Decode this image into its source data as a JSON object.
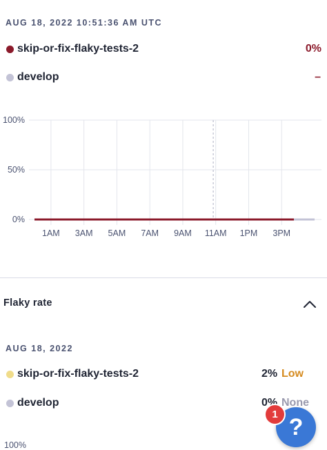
{
  "header": {
    "timestamp": "AUG 18, 2022 10:51:36 AM UTC"
  },
  "legend": [
    {
      "name": "skip-or-fix-flaky-tests-2",
      "value": "0%",
      "color": "#8b1a2b"
    },
    {
      "name": "develop",
      "value": "–",
      "color": "#c3c3d6"
    }
  ],
  "chart_data": {
    "type": "line",
    "y_ticks": [
      "100%",
      "50%",
      "0%"
    ],
    "x_ticks": [
      "1AM",
      "3AM",
      "5AM",
      "7AM",
      "9AM",
      "11AM",
      "1PM",
      "3PM"
    ],
    "ylim": [
      0,
      100
    ],
    "series": [
      {
        "name": "skip-or-fix-flaky-tests-2",
        "color": "#8b1a2b",
        "x": [
          "12AM",
          "3:45PM"
        ],
        "y": [
          0,
          0
        ]
      },
      {
        "name": "develop",
        "color": "#c3c3d6",
        "x": [
          "3:45PM",
          "5PM"
        ],
        "y": [
          0,
          0
        ]
      }
    ],
    "cursor_x": "10:51AM",
    "grid": true
  },
  "flaky_rate": {
    "title": "Flaky rate",
    "date": "AUG 18, 2022",
    "rows": [
      {
        "name": "skip-or-fix-flaky-tests-2",
        "value": "2%",
        "tag": "Low",
        "dot_color": "#f0dc8a",
        "tag_color": "#d58a1e"
      },
      {
        "name": "develop",
        "value": "0%",
        "tag": "None",
        "dot_color": "#c3c3d6",
        "tag_color": "#9a9aae"
      }
    ],
    "y_top_label": "100%"
  },
  "help": {
    "label": "?",
    "badge": "1"
  }
}
